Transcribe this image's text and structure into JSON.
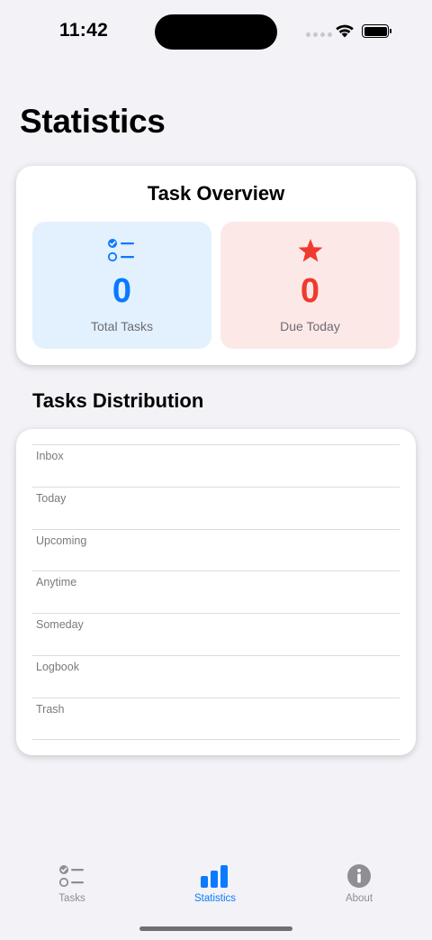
{
  "status_bar": {
    "time": "11:42"
  },
  "page": {
    "title": "Statistics"
  },
  "overview": {
    "title": "Task Overview",
    "total": {
      "value": "0",
      "label": "Total Tasks",
      "icon": "checklist-icon",
      "color": "#0a7aff"
    },
    "due": {
      "value": "0",
      "label": "Due Today",
      "icon": "star-icon",
      "color": "#f03a2e"
    }
  },
  "distribution": {
    "heading": "Tasks Distribution",
    "rows": [
      "Inbox",
      "Today",
      "Upcoming",
      "Anytime",
      "Someday",
      "Logbook",
      "Trash"
    ]
  },
  "tab_bar": {
    "items": [
      {
        "label": "Tasks",
        "icon": "checklist-icon",
        "selected": false
      },
      {
        "label": "Statistics",
        "icon": "bar-chart-icon",
        "selected": true
      },
      {
        "label": "About",
        "icon": "info-icon",
        "selected": false
      }
    ],
    "accent": "#0a7aff"
  }
}
